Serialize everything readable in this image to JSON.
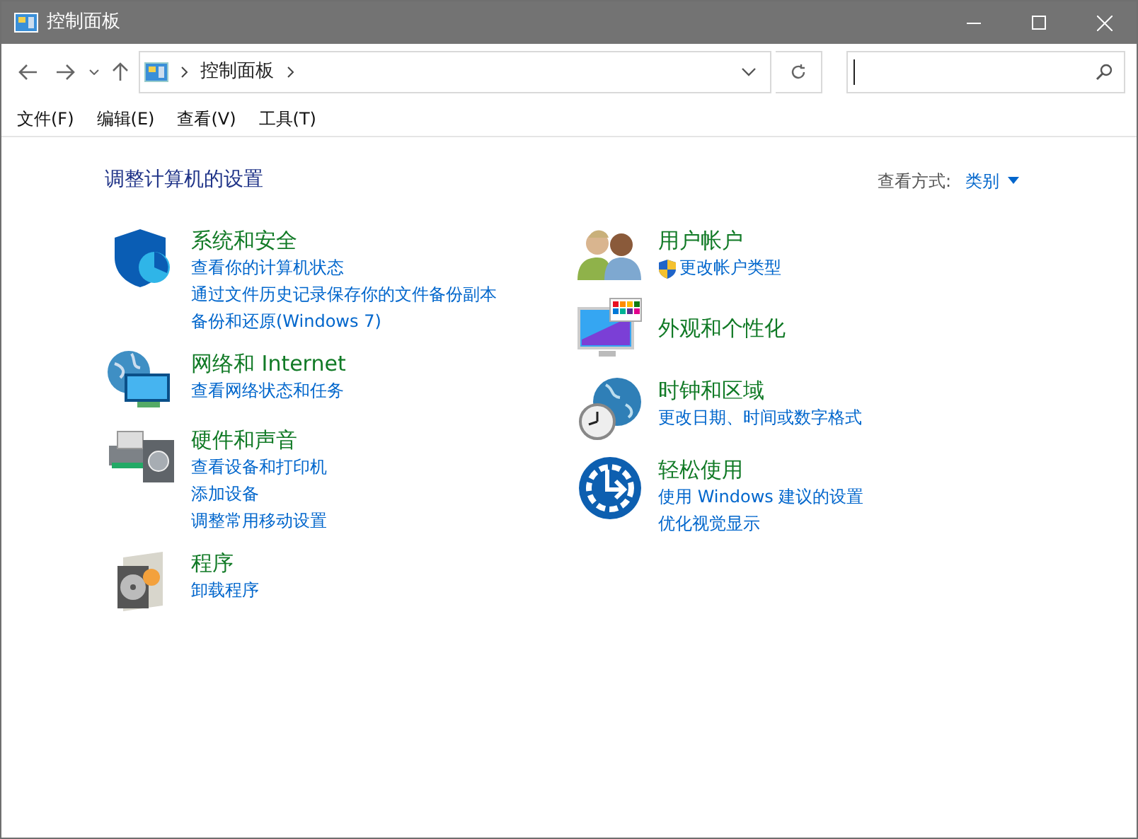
{
  "window": {
    "title": "控制面板"
  },
  "address": {
    "crumbs": [
      "控制面板"
    ]
  },
  "menu": [
    "文件(F)",
    "编辑(E)",
    "查看(V)",
    "工具(T)"
  ],
  "heading": "调整计算机的设置",
  "view_by": {
    "label": "查看方式:",
    "value": "类别"
  },
  "columns": [
    [
      {
        "title": "系统和安全",
        "links": [
          {
            "text": "查看你的计算机状态",
            "shield": false
          },
          {
            "text": "通过文件历史记录保存你的文件备份副本",
            "shield": false
          },
          {
            "text": "备份和还原(Windows 7)",
            "shield": false
          }
        ]
      },
      {
        "title": "网络和 Internet",
        "links": [
          {
            "text": "查看网络状态和任务",
            "shield": false
          }
        ]
      },
      {
        "title": "硬件和声音",
        "links": [
          {
            "text": "查看设备和打印机",
            "shield": false
          },
          {
            "text": "添加设备",
            "shield": false
          },
          {
            "text": "调整常用移动设置",
            "shield": false
          }
        ]
      },
      {
        "title": "程序",
        "links": [
          {
            "text": "卸载程序",
            "shield": false
          }
        ]
      }
    ],
    [
      {
        "title": "用户帐户",
        "links": [
          {
            "text": "更改帐户类型",
            "shield": true
          }
        ]
      },
      {
        "title": "外观和个性化"
      },
      {
        "title": "时钟和区域",
        "links": [
          {
            "text": "更改日期、时间或数字格式",
            "shield": false
          }
        ]
      },
      {
        "title": "轻松使用",
        "links": [
          {
            "text": "使用 Windows 建议的设置",
            "shield": false
          },
          {
            "text": "优化视觉显示",
            "shield": false
          }
        ]
      }
    ]
  ]
}
